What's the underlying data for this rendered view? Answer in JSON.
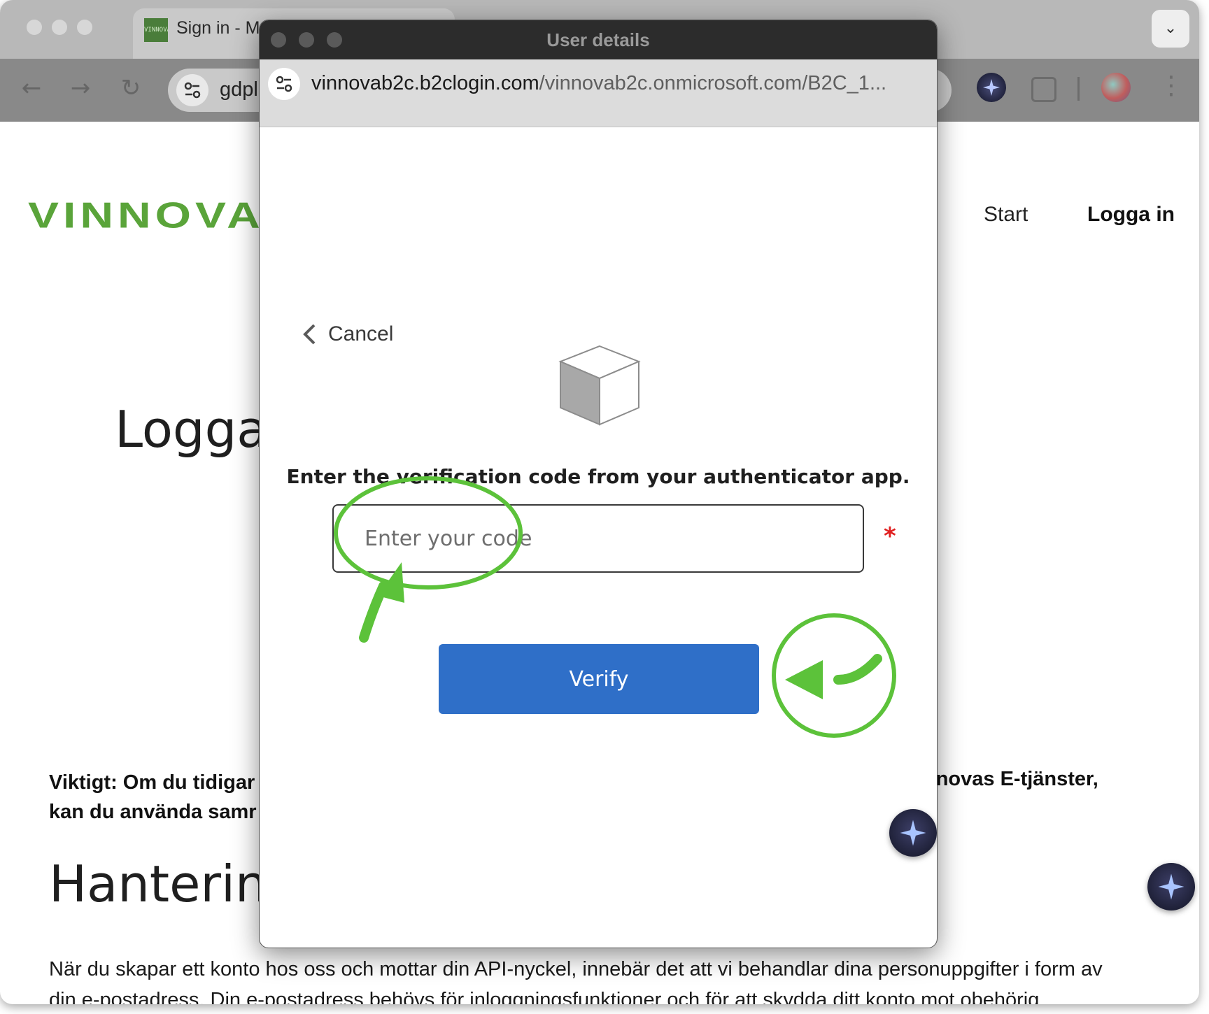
{
  "browser": {
    "tab_title": "Sign in - M",
    "tab_favicon_text": "VINNOVA",
    "omnibox_text": "gdpl",
    "tabs_menu_icon": "chevron-down-icon"
  },
  "site": {
    "logo_text": "VINNOVA",
    "nav_start": "Start",
    "nav_login": "Logga in",
    "page_heading": "Logga",
    "important_line1": "Viktigt: Om du tidigar",
    "important_line2": "kan du använda samr",
    "important_right": "nnovas E-tjänster,",
    "section_heading": "Hantering",
    "paragraph_line1": "När du skapar ett konto hos oss och mottar din API-nyckel, innebär det att vi behandlar dina personuppgifter i form av",
    "paragraph_line2": "din e-postadress. Din e-postadress behövs för inloggningsfunktioner och för att skydda ditt konto mot obehörig"
  },
  "popup": {
    "window_title": "User details",
    "url_host": "vinnovab2c.b2clogin.com",
    "url_path": "/vinnovab2c.onmicrosoft.com/B2C_1...",
    "cancel_label": "Cancel",
    "instruction": "Enter the verification code from your authenticator app.",
    "code_placeholder": "Enter your code",
    "code_value": "",
    "required_mark": "*",
    "verify_label": "Verify"
  },
  "colors": {
    "brand_green": "#5aa43a",
    "annotation_green": "#5cc23a",
    "verify_blue": "#2f6fc8",
    "required_red": "#e02020"
  }
}
